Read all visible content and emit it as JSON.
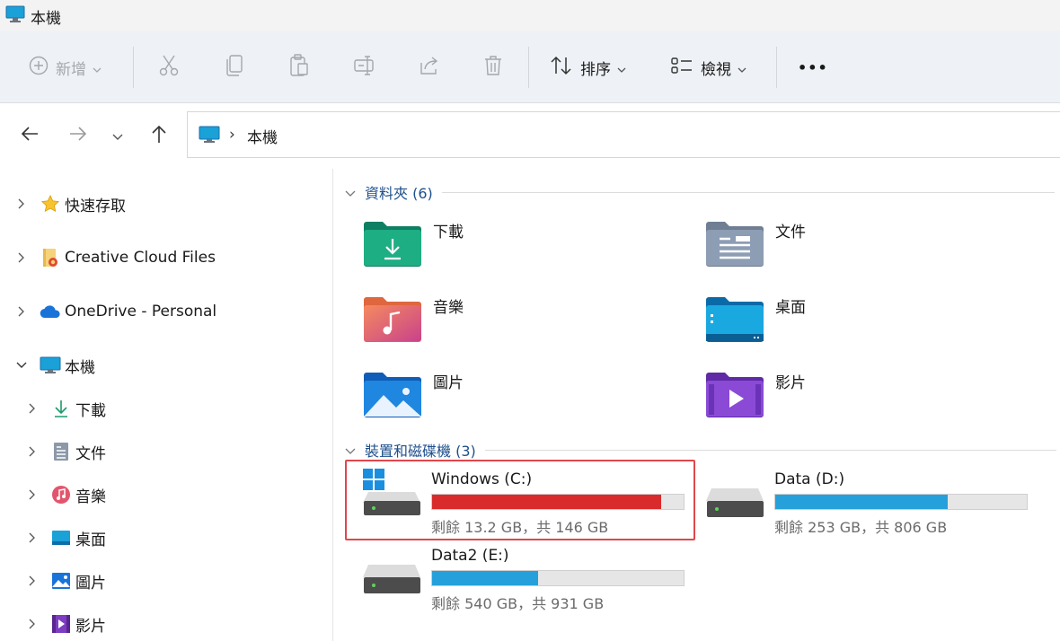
{
  "window": {
    "title": "本機"
  },
  "toolbar": {
    "new_label": "新增",
    "sort_label": "排序",
    "view_label": "檢視",
    "more_label": "•••"
  },
  "address": {
    "path": "本機",
    "separator": "›"
  },
  "sidebar": {
    "items": [
      {
        "label": "快速存取"
      },
      {
        "label": "Creative Cloud Files"
      },
      {
        "label": "OneDrive - Personal"
      },
      {
        "label": "本機"
      },
      {
        "label": "下載"
      },
      {
        "label": "文件"
      },
      {
        "label": "音樂"
      },
      {
        "label": "桌面"
      },
      {
        "label": "圖片"
      },
      {
        "label": "影片"
      }
    ]
  },
  "folders_section": {
    "title": "資料夾 (6)",
    "items": [
      {
        "label": "下載"
      },
      {
        "label": "文件"
      },
      {
        "label": "音樂"
      },
      {
        "label": "桌面"
      },
      {
        "label": "圖片"
      },
      {
        "label": "影片"
      }
    ]
  },
  "drives_section": {
    "title": "裝置和磁碟機 (3)",
    "items": [
      {
        "name": "Windows (C:)",
        "free_text": "剩餘 13.2 GB，共 146 GB",
        "used_fraction": 0.91,
        "bar_color": "#d92b2b"
      },
      {
        "name": "Data (D:)",
        "free_text": "剩餘 253 GB，共 806 GB",
        "used_fraction": 0.686,
        "bar_color": "#26a0da"
      },
      {
        "name": "Data2 (E:)",
        "free_text": "剩餘 540 GB，共 931 GB",
        "used_fraction": 0.42,
        "bar_color": "#26a0da"
      }
    ]
  },
  "colors": {
    "accent": "#26a0da",
    "danger": "#d92b2b",
    "highlight": "#e0474c"
  }
}
